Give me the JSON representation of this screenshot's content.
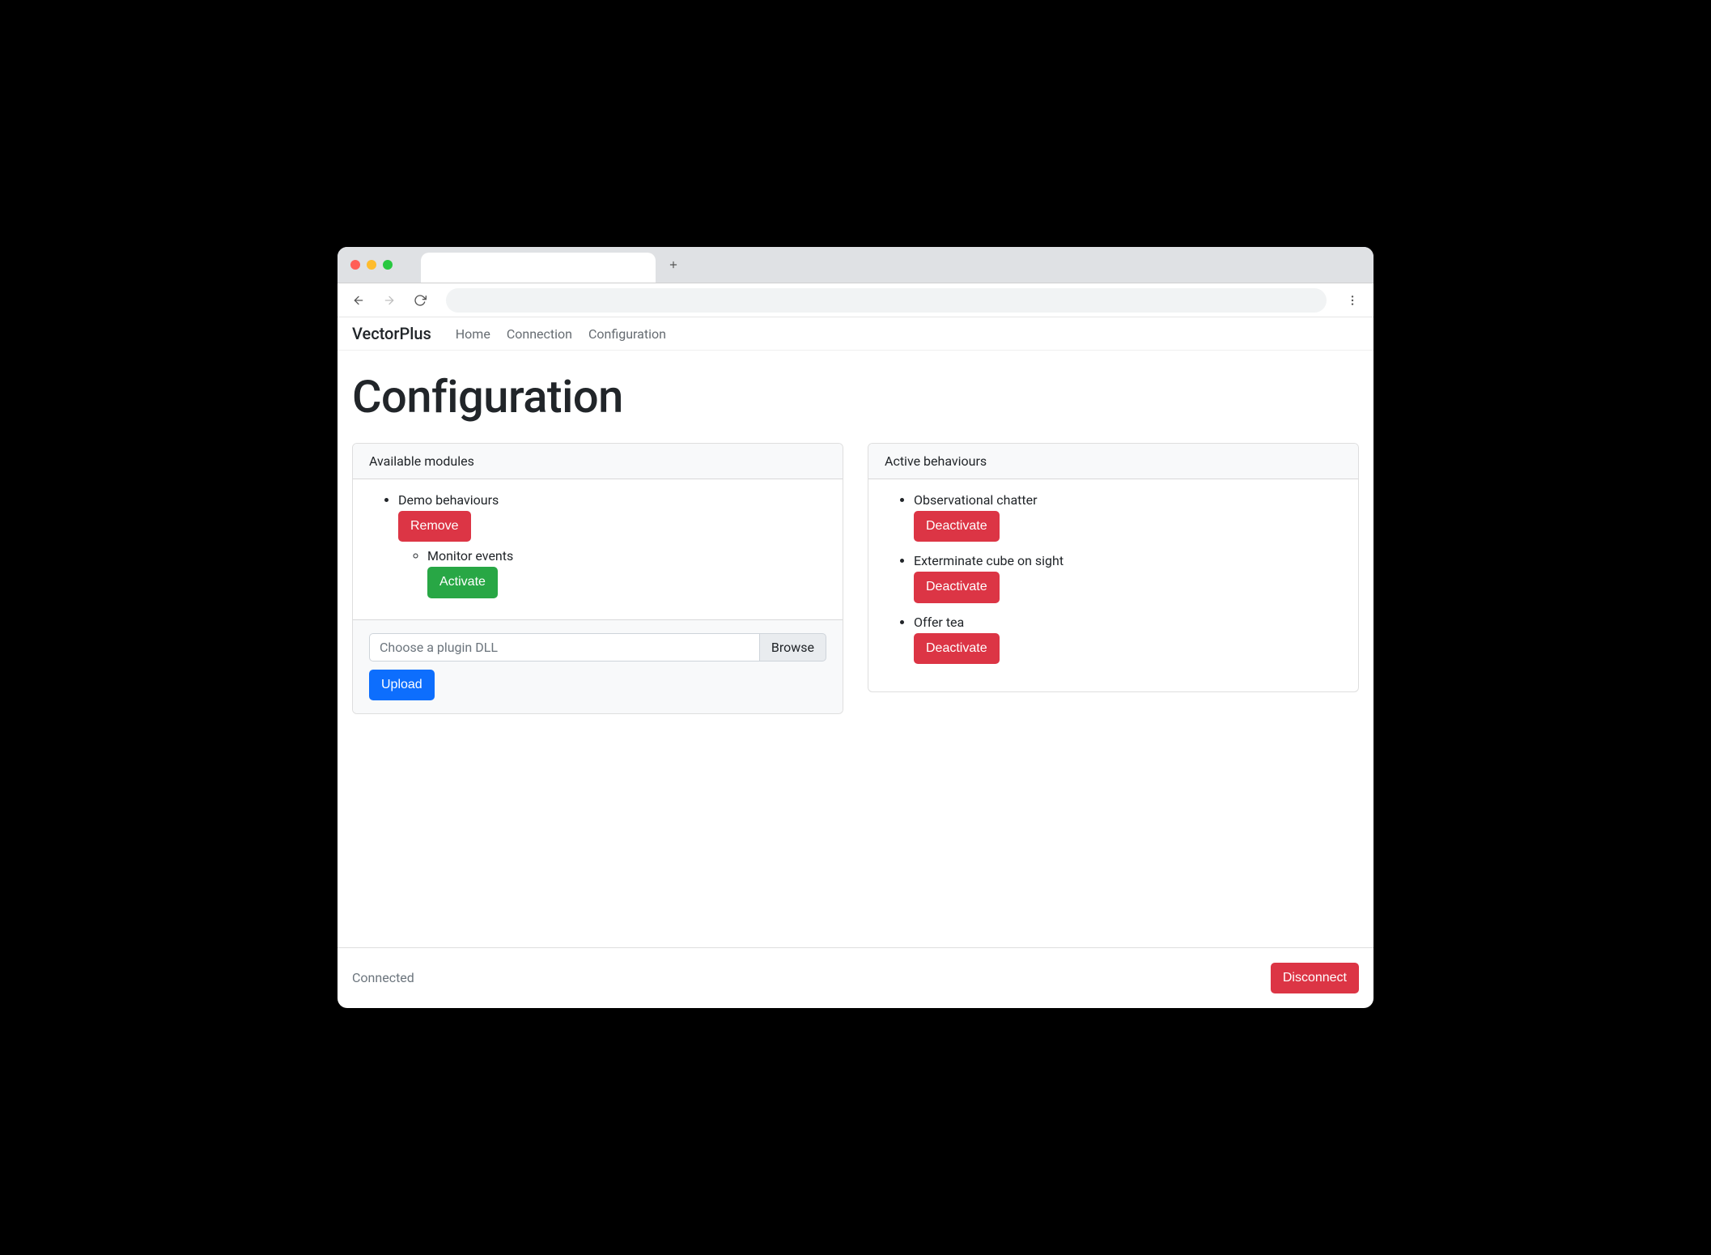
{
  "brand": "VectorPlus",
  "nav": {
    "items": [
      "Home",
      "Connection",
      "Configuration"
    ]
  },
  "page": {
    "title": "Configuration"
  },
  "modules_card": {
    "header": "Available modules",
    "modules": [
      {
        "name": "Demo behaviours",
        "remove_label": "Remove",
        "behaviours": [
          {
            "name": "Monitor events",
            "action_label": "Activate"
          }
        ]
      }
    ],
    "file_placeholder": "Choose a plugin DLL",
    "browse_label": "Browse",
    "upload_label": "Upload"
  },
  "behaviours_card": {
    "header": "Active behaviours",
    "items": [
      {
        "name": "Observational chatter",
        "action_label": "Deactivate"
      },
      {
        "name": "Exterminate cube on sight",
        "action_label": "Deactivate"
      },
      {
        "name": "Offer tea",
        "action_label": "Deactivate"
      }
    ]
  },
  "footer": {
    "status": "Connected",
    "disconnect_label": "Disconnect"
  }
}
